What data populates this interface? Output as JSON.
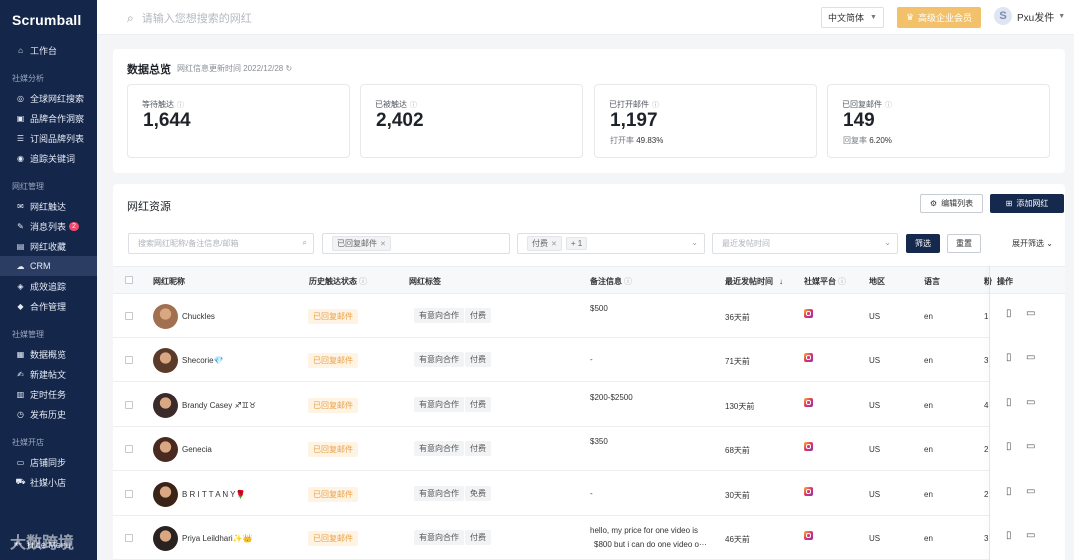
{
  "sidebar": {
    "logo": "Scrumball",
    "items": [
      {
        "type": "item",
        "label": "工作台",
        "icon": "home-icon"
      },
      {
        "type": "group",
        "label": "社媒分析"
      },
      {
        "type": "item",
        "label": "全球网红搜索",
        "icon": "compass-icon"
      },
      {
        "type": "item",
        "label": "品牌合作洞察",
        "icon": "briefcase-icon"
      },
      {
        "type": "item",
        "label": "订阅品牌列表",
        "icon": "list-icon"
      },
      {
        "type": "item",
        "label": "追踪关键词",
        "icon": "target-icon"
      },
      {
        "type": "group",
        "label": "网红管理"
      },
      {
        "type": "item",
        "label": "网红触达",
        "icon": "mail-icon"
      },
      {
        "type": "item",
        "label": "消息列表",
        "icon": "message-icon",
        "badge": "2"
      },
      {
        "type": "item",
        "label": "网红收藏",
        "icon": "folder-icon"
      },
      {
        "type": "item",
        "label": "CRM",
        "icon": "crm-icon",
        "active": true
      },
      {
        "type": "item",
        "label": "成效追踪",
        "icon": "chart-icon"
      },
      {
        "type": "item",
        "label": "合作管理",
        "icon": "handshake-icon"
      },
      {
        "type": "group",
        "label": "社媒管理"
      },
      {
        "type": "item",
        "label": "数据概览",
        "icon": "dashboard-icon"
      },
      {
        "type": "item",
        "label": "新建帖文",
        "icon": "edit-icon"
      },
      {
        "type": "item",
        "label": "定时任务",
        "icon": "calendar-icon"
      },
      {
        "type": "item",
        "label": "发布历史",
        "icon": "history-icon"
      },
      {
        "type": "group",
        "label": "社媒开店"
      },
      {
        "type": "item",
        "label": "店铺同步",
        "icon": "store-icon"
      },
      {
        "type": "item",
        "label": "社媒小店",
        "icon": "cart-icon"
      }
    ],
    "hide_menu": "Hide Menu"
  },
  "topbar": {
    "search_placeholder": "请输入您想搜索的网红",
    "language": "中文简体",
    "vip": "高级企业会员",
    "avatar_letter": "S",
    "user": "Pxu发件"
  },
  "overview": {
    "title": "数据总览",
    "subtitle": "网红信息更新时间 2022/12/28",
    "stats": [
      {
        "label": "等待触达",
        "value": "1,644",
        "rate_label": "",
        "rate": ""
      },
      {
        "label": "已被触达",
        "value": "2,402",
        "rate_label": "",
        "rate": ""
      },
      {
        "label": "已打开邮件",
        "value": "1,197",
        "rate_label": "打开率",
        "rate": "49.83%"
      },
      {
        "label": "已回复邮件",
        "value": "149",
        "rate_label": "回复率",
        "rate": "6.20%"
      }
    ]
  },
  "resource": {
    "title": "网红资源",
    "edit_list": "编辑列表",
    "add_influencer": "添加网红",
    "filters": {
      "search_placeholder": "搜索网红昵称/备注信息/邮箱",
      "status_chip": "已回复邮件",
      "pay_chip": "付费",
      "pay_more": "+ 1",
      "recent_placeholder": "最近发帖时间",
      "filter_btn": "筛选",
      "reset_btn": "重置",
      "expand": "展开筛选"
    },
    "columns": {
      "nickname": "网红昵称",
      "history_status": "历史触达状态",
      "tags": "网红标签",
      "notes": "备注信息",
      "last_post": "最近发帖时间",
      "platform": "社媒平台",
      "region": "地区",
      "language": "语言",
      "more": "粉",
      "actions": "操作"
    },
    "rows": [
      {
        "name": "Chuckles",
        "status": "已回复邮件",
        "tags": [
          "有意向合作",
          "付费"
        ],
        "note": "$500",
        "note2": "",
        "last_post": "36天前",
        "region": "US",
        "lang": "en",
        "more": "1.",
        "avatar_color": "#a07050"
      },
      {
        "name": "Shecorie💎",
        "status": "已回复邮件",
        "tags": [
          "有意向合作",
          "付费"
        ],
        "note": "-",
        "note2": "",
        "last_post": "71天前",
        "region": "US",
        "lang": "en",
        "more": "3.",
        "avatar_color": "#5a3a2a"
      },
      {
        "name": "Brandy Casey ♐♊♉",
        "status": "已回复邮件",
        "tags": [
          "有意向合作",
          "付费"
        ],
        "note": "$200-$2500",
        "note2": "",
        "last_post": "130天前",
        "region": "US",
        "lang": "en",
        "more": "4.",
        "avatar_color": "#3a2a2a"
      },
      {
        "name": "Genecia",
        "status": "已回复邮件",
        "tags": [
          "有意向合作",
          "付费"
        ],
        "note": "$350",
        "note2": "",
        "last_post": "68天前",
        "region": "US",
        "lang": "en",
        "more": "2.",
        "avatar_color": "#4a2a20"
      },
      {
        "name": "B R I T T A N Y🌹",
        "status": "已回复邮件",
        "tags": [
          "有意向合作",
          "免费"
        ],
        "note": "-",
        "note2": "",
        "last_post": "30天前",
        "region": "US",
        "lang": "en",
        "more": "2.",
        "avatar_color": "#3a2418"
      },
      {
        "name": "Priya Leildhari✨👑",
        "status": "已回复邮件",
        "tags": [
          "有意向合作",
          "付费"
        ],
        "note": "hello, my price for one video is",
        "note2": "$800 but i can do one video o···",
        "last_post": "46天前",
        "region": "US",
        "lang": "en",
        "more": "3.",
        "avatar_color": "#2a2220"
      }
    ]
  },
  "watermark": "大数跨境"
}
